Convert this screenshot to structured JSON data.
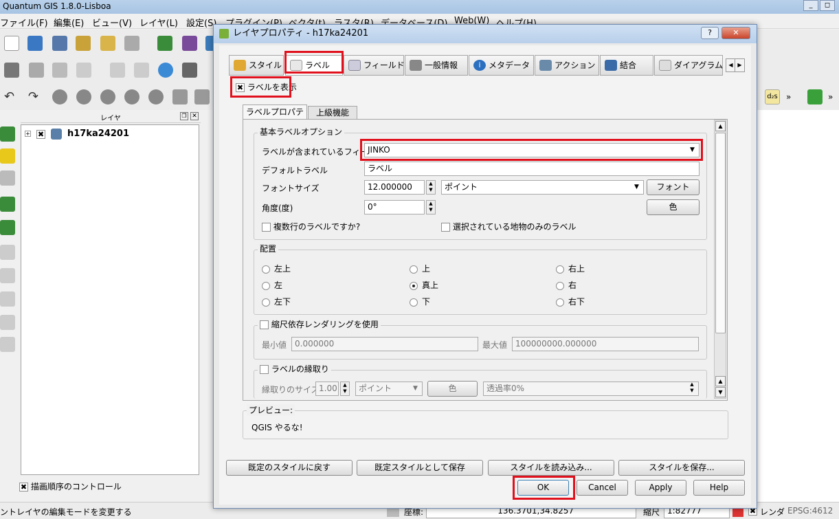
{
  "app": {
    "title": "Quantum GIS 1.8.0-Lisboa",
    "menu": [
      "ファイル(F)",
      "編集(E)",
      "ビュー(V)",
      "レイヤ(L)",
      "設定(S)",
      "プラグイン(P)",
      "ベクタ(t)",
      "ラスタ(R)",
      "データベース(D)",
      "Web(W)",
      "ヘルプ(H)"
    ]
  },
  "layers_panel": {
    "title": "レイヤ",
    "layer_name": "h17ka24201",
    "draw_order_label": "描画順序のコントロール"
  },
  "statusbar": {
    "message": "ントレイヤの編集モードを変更する",
    "coord_label": "座標:",
    "coord_value": "136.3701,34.8257",
    "scale_label": "縮尺",
    "scale_value": "1:82777",
    "render_label": "レンダ",
    "crs": "EPSG:4612"
  },
  "dialog": {
    "title": "レイヤプロパティ - h17ka24201",
    "help_btn": "?",
    "tabs": [
      "スタイル",
      "ラベル",
      "フィールド",
      "一般情報",
      "メタデータ",
      "アクション",
      "結合",
      "ダイアグラム"
    ],
    "show_labels": "ラベルを表示",
    "subtabs": [
      "ラベルプロパティ",
      "上級機能"
    ],
    "basic": {
      "group_title": "基本ラベルオプション",
      "field_label": "ラベルが含まれているフィールド",
      "field_value": "JINKO",
      "default_label": "デフォルトラベル",
      "default_value": "ラベル",
      "font_size_label": "フォントサイズ",
      "font_size_value": "12.000000",
      "font_unit": "ポイント",
      "font_button": "フォント",
      "angle_label": "角度(度)",
      "angle_value": "0°",
      "color_button": "色",
      "multiline": "複数行のラベルですか?",
      "selected_only": "選択されている地物のみのラベル"
    },
    "placement": {
      "group_title": "配置",
      "options": [
        "左上",
        "上",
        "右上",
        "左",
        "真上",
        "右",
        "左下",
        "下",
        "右下"
      ],
      "selected": "真上"
    },
    "scale": {
      "group_title": "縮尺依存レンダリングを使用",
      "min_label": "最小値",
      "min_value": "0.000000",
      "max_label": "最大値",
      "max_value": "100000000.000000"
    },
    "buffer": {
      "group_title": "ラベルの縁取り",
      "size_label": "縁取りのサイズ",
      "size_value": "1.00",
      "unit": "ポイント",
      "color_button": "色",
      "transparency": "透過率0%"
    },
    "preview": {
      "title": "プレビュー:",
      "text": "QGIS やるな!"
    },
    "style_buttons": [
      "既定のスタイルに戻す",
      "既定スタイルとして保存",
      "スタイルを読み込み...",
      "スタイルを保存..."
    ],
    "ok": "OK",
    "cancel": "Cancel",
    "apply": "Apply",
    "help": "Help"
  },
  "colors": {
    "highlight": "#e0101c",
    "titlebar": "#b9d1ea"
  }
}
